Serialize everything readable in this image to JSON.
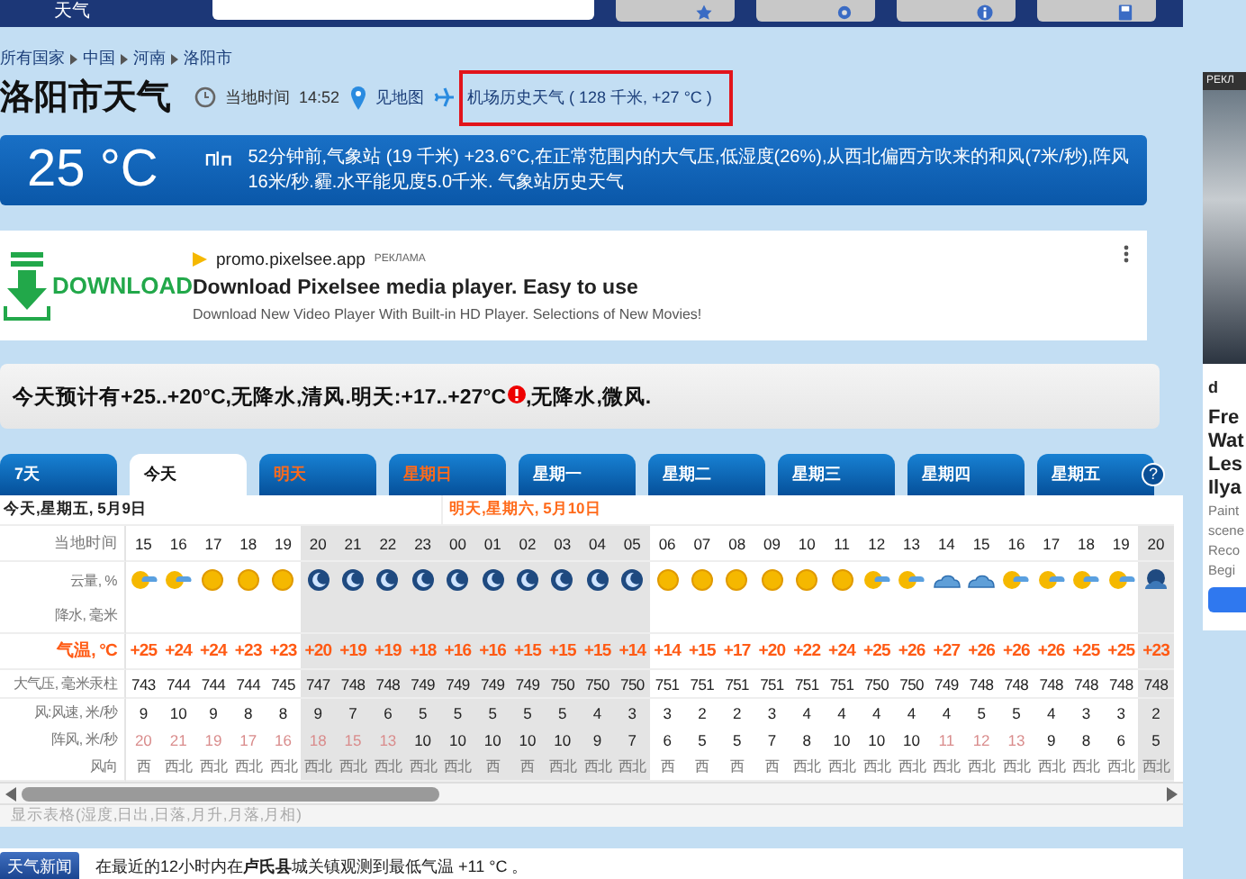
{
  "top_bar": {
    "site_title": "天气"
  },
  "breadcrumb": [
    "所有国家",
    "中国",
    "河南",
    "洛阳市"
  ],
  "header": {
    "title": "洛阳市天气",
    "time_label": "当地时间",
    "time": "14:52",
    "map_link": "见地图",
    "airport_link": {
      "text": "机场历史天气 ( 128 千米, +27 °C )",
      "highlighted": true
    }
  },
  "current": {
    "temperature": "25 °C",
    "observation": "52分钟前,气象站 (19 千米) +23.6°C,在正常范围内的大气压,低湿度(26%),从西北偏西方吹来的和风(7米/秒),阵风16米/秒.霾.水平能见度5.0千米.",
    "history_link": "气象站历史天气"
  },
  "ad": {
    "logo_text": "DOWNLOAD",
    "domain": "promo.pixelsee.app",
    "label": "РЕКЛАМА",
    "title": "Download Pixelsee media player. Easy to use",
    "description": "Download New Video Player With Built-in HD Player. Selections of New Movies!"
  },
  "forecast": {
    "text": "今天预计有+25..+20°C,无降水,清风.明天:+17..+27°C",
    "warning": true,
    "text_after": ",无降水,微风."
  },
  "tabs": [
    {
      "label": "7天",
      "selected": false,
      "weekend": false
    },
    {
      "label": "今天",
      "selected": true,
      "weekend": false
    },
    {
      "label": "明天",
      "selected": false,
      "weekend": true
    },
    {
      "label": "星期日",
      "selected": false,
      "weekend": true
    },
    {
      "label": "星期一",
      "selected": false,
      "weekend": false
    },
    {
      "label": "星期二",
      "selected": false,
      "weekend": false
    },
    {
      "label": "星期三",
      "selected": false,
      "weekend": false
    },
    {
      "label": "星期四",
      "selected": false,
      "weekend": false
    },
    {
      "label": "星期五",
      "selected": false,
      "weekend": false
    }
  ],
  "help_label": "?",
  "table": {
    "row_labels": [
      "当地时间",
      "云量, %",
      "降水, 毫米",
      "气温, °C",
      "大气压, 毫米汞柱",
      "风:风速, 米/秒",
      "阵风, 米/秒",
      "风向"
    ],
    "days": [
      {
        "label": "今天,星期五, 5月9日",
        "weekend": false,
        "hours": [
          {
            "time": "15",
            "kind": "partly",
            "night": false,
            "temp": "+25",
            "pressure": "743",
            "wind": "9",
            "gust": "20",
            "gust_faint": true,
            "dir": "西"
          },
          {
            "time": "16",
            "kind": "partly",
            "night": false,
            "temp": "+24",
            "pressure": "744",
            "wind": "10",
            "gust": "21",
            "gust_faint": true,
            "dir": "西北"
          },
          {
            "time": "17",
            "kind": "sun",
            "night": false,
            "temp": "+24",
            "pressure": "744",
            "wind": "9",
            "gust": "19",
            "gust_faint": true,
            "dir": "西北"
          },
          {
            "time": "18",
            "kind": "sun",
            "night": false,
            "temp": "+23",
            "pressure": "744",
            "wind": "8",
            "gust": "17",
            "gust_faint": true,
            "dir": "西北"
          },
          {
            "time": "19",
            "kind": "sun",
            "night": false,
            "temp": "+23",
            "pressure": "745",
            "wind": "8",
            "gust": "16",
            "gust_faint": true,
            "dir": "西北"
          },
          {
            "time": "20",
            "kind": "moon",
            "night": true,
            "temp": "+20",
            "pressure": "747",
            "wind": "9",
            "gust": "18",
            "gust_faint": true,
            "dir": "西北"
          },
          {
            "time": "21",
            "kind": "moon",
            "night": true,
            "temp": "+19",
            "pressure": "748",
            "wind": "7",
            "gust": "15",
            "gust_faint": true,
            "dir": "西北"
          },
          {
            "time": "22",
            "kind": "moon",
            "night": true,
            "temp": "+19",
            "pressure": "748",
            "wind": "6",
            "gust": "13",
            "gust_faint": true,
            "dir": "西北"
          },
          {
            "time": "23",
            "kind": "moon",
            "night": true,
            "temp": "+18",
            "pressure": "749",
            "wind": "5",
            "gust": "10",
            "gust_faint": false,
            "dir": "西北"
          }
        ]
      },
      {
        "label": "明天,星期六, 5月10日",
        "weekend": true,
        "hours": [
          {
            "time": "00",
            "kind": "moon",
            "night": true,
            "temp": "+16",
            "pressure": "749",
            "wind": "5",
            "gust": "10",
            "gust_faint": false,
            "dir": "西北"
          },
          {
            "time": "01",
            "kind": "moon",
            "night": true,
            "temp": "+16",
            "pressure": "749",
            "wind": "5",
            "gust": "10",
            "gust_faint": false,
            "dir": "西"
          },
          {
            "time": "02",
            "kind": "moon",
            "night": true,
            "temp": "+15",
            "pressure": "749",
            "wind": "5",
            "gust": "10",
            "gust_faint": false,
            "dir": "西"
          },
          {
            "time": "03",
            "kind": "moon",
            "night": true,
            "temp": "+15",
            "pressure": "750",
            "wind": "5",
            "gust": "10",
            "gust_faint": false,
            "dir": "西北"
          },
          {
            "time": "04",
            "kind": "moon",
            "night": true,
            "temp": "+15",
            "pressure": "750",
            "wind": "4",
            "gust": "9",
            "gust_faint": false,
            "dir": "西北"
          },
          {
            "time": "05",
            "kind": "moon",
            "night": true,
            "temp": "+14",
            "pressure": "750",
            "wind": "3",
            "gust": "7",
            "gust_faint": false,
            "dir": "西北"
          },
          {
            "time": "06",
            "kind": "sun",
            "night": false,
            "temp": "+14",
            "pressure": "751",
            "wind": "3",
            "gust": "6",
            "gust_faint": false,
            "dir": "西"
          },
          {
            "time": "07",
            "kind": "sun",
            "night": false,
            "temp": "+15",
            "pressure": "751",
            "wind": "2",
            "gust": "5",
            "gust_faint": false,
            "dir": "西"
          },
          {
            "time": "08",
            "kind": "sun",
            "night": false,
            "temp": "+17",
            "pressure": "751",
            "wind": "2",
            "gust": "5",
            "gust_faint": false,
            "dir": "西"
          },
          {
            "time": "09",
            "kind": "sun",
            "night": false,
            "temp": "+20",
            "pressure": "751",
            "wind": "3",
            "gust": "7",
            "gust_faint": false,
            "dir": "西"
          },
          {
            "time": "10",
            "kind": "sun",
            "night": false,
            "temp": "+22",
            "pressure": "751",
            "wind": "4",
            "gust": "8",
            "gust_faint": false,
            "dir": "西北"
          },
          {
            "time": "11",
            "kind": "sun",
            "night": false,
            "temp": "+24",
            "pressure": "751",
            "wind": "4",
            "gust": "10",
            "gust_faint": false,
            "dir": "西北"
          },
          {
            "time": "12",
            "kind": "partly",
            "night": false,
            "temp": "+25",
            "pressure": "750",
            "wind": "4",
            "gust": "10",
            "gust_faint": false,
            "dir": "西北"
          },
          {
            "time": "13",
            "kind": "partly",
            "night": false,
            "temp": "+26",
            "pressure": "750",
            "wind": "4",
            "gust": "10",
            "gust_faint": false,
            "dir": "西北"
          },
          {
            "time": "14",
            "kind": "cloudy",
            "night": false,
            "temp": "+27",
            "pressure": "749",
            "wind": "4",
            "gust": "11",
            "gust_faint": true,
            "dir": "西北"
          },
          {
            "time": "15",
            "kind": "cloudy",
            "night": false,
            "temp": "+26",
            "pressure": "748",
            "wind": "5",
            "gust": "12",
            "gust_faint": true,
            "dir": "西北"
          },
          {
            "time": "16",
            "kind": "partly",
            "night": false,
            "temp": "+26",
            "pressure": "748",
            "wind": "5",
            "gust": "13",
            "gust_faint": true,
            "dir": "西北"
          },
          {
            "time": "17",
            "kind": "partly",
            "night": false,
            "temp": "+26",
            "pressure": "748",
            "wind": "4",
            "gust": "9",
            "gust_faint": false,
            "dir": "西北"
          },
          {
            "time": "18",
            "kind": "partly",
            "night": false,
            "temp": "+25",
            "pressure": "748",
            "wind": "3",
            "gust": "8",
            "gust_faint": false,
            "dir": "西北"
          },
          {
            "time": "19",
            "kind": "partly",
            "night": false,
            "temp": "+25",
            "pressure": "748",
            "wind": "3",
            "gust": "6",
            "gust_faint": false,
            "dir": "西北"
          },
          {
            "time": "20",
            "kind": "moon-cloud",
            "night": true,
            "temp": "+23",
            "pressure": "748",
            "wind": "2",
            "gust": "5",
            "gust_faint": false,
            "dir": "西北"
          }
        ]
      }
    ],
    "more_link": "显示表格(湿度,日出,日落,月升,月落,月相)"
  },
  "news": {
    "badge": "天气新闻",
    "text": "在最近的12小时内在**卢氏县**城关镇观测到最低气温 +11 °C 。"
  },
  "side_ad": {
    "label": "РЕКЛ",
    "title_lines": [
      "Fre",
      "Wat",
      "Les",
      "Ilya"
    ],
    "text_lines": [
      "Paint",
      "scene",
      "Reco",
      "Begi"
    ],
    "logo": "d"
  }
}
